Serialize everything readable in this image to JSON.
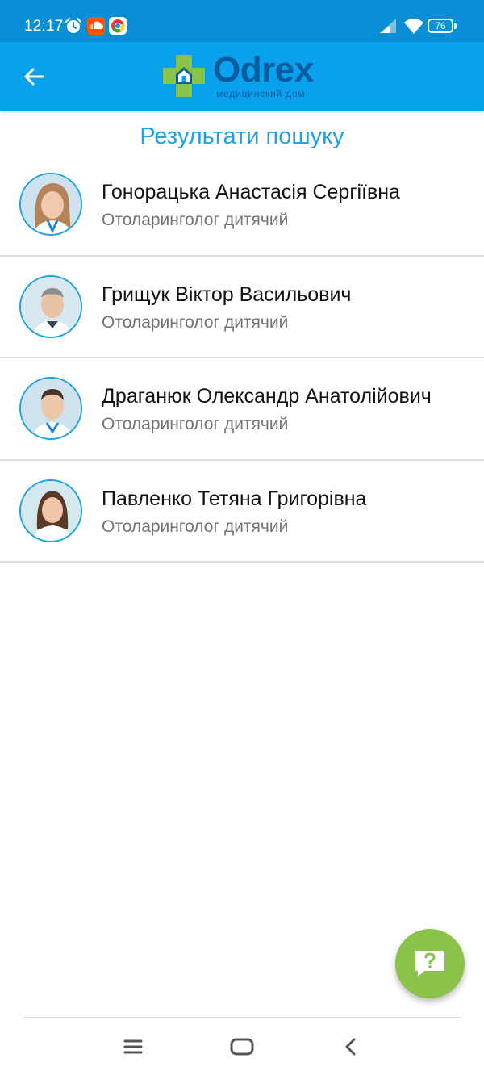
{
  "status_bar": {
    "time": "12:17",
    "battery": "76",
    "icons": [
      "alarm-icon",
      "soundcloud-icon",
      "chrome-icon",
      "signal-icon",
      "wifi-icon",
      "battery-icon"
    ]
  },
  "app_bar": {
    "back_icon": "arrow-left-icon",
    "logo": {
      "name": "Odrex",
      "tagline": "медицинский дом"
    }
  },
  "results": {
    "title": "Результати пошуку",
    "doctors": [
      {
        "name": "Гонорацька Анастасія Сергіївна",
        "specialty": "Отоларинголог дитячий"
      },
      {
        "name": "Грищук Віктор Васильович",
        "specialty": "Отоларинголог дитячий"
      },
      {
        "name": "Драганюк Олександр Анатолійович",
        "specialty": "Отоларинголог дитячий"
      },
      {
        "name": "Павленко Тетяна Григорівна",
        "specialty": "Отоларинголог дитячий"
      }
    ]
  },
  "fab": {
    "icon": "help-chat-icon"
  },
  "nav_bar": {
    "icons": [
      "menu-icon",
      "home-icon",
      "back-icon"
    ]
  },
  "colors": {
    "status_bar": "#0a8fd6",
    "app_bar": "#0aa1ec",
    "accent": "#1ea2e0",
    "fab": "#8bc34a",
    "logo_text": "#0a5ca0"
  }
}
